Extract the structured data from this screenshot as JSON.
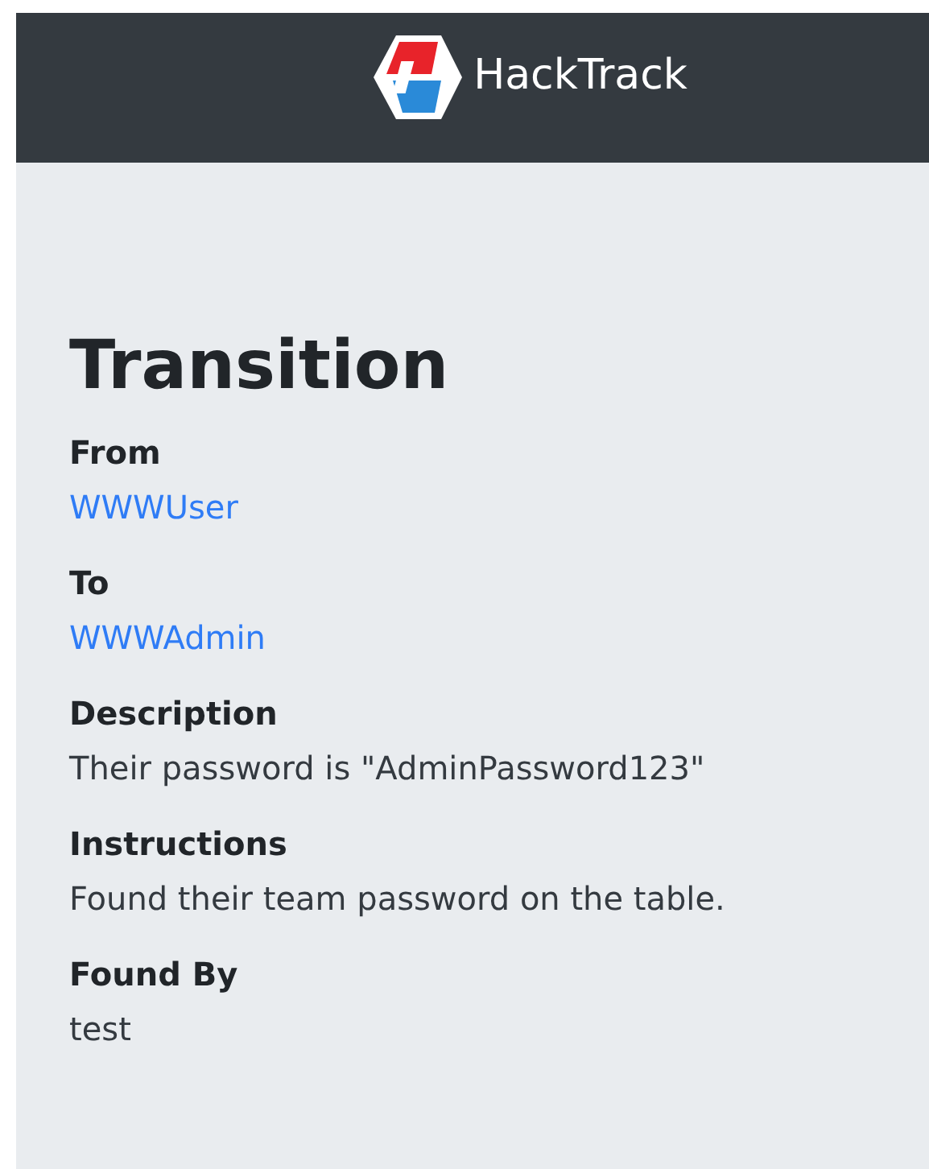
{
  "navbar": {
    "brand": "HackTrack"
  },
  "heading": "Transition",
  "fields": [
    {
      "label": "From",
      "value": "WWWUser",
      "kind": "link"
    },
    {
      "label": "To",
      "value": "WWWAdmin",
      "kind": "link"
    },
    {
      "label": "Description",
      "value": "Their password is \"AdminPassword123\"",
      "kind": "text"
    },
    {
      "label": "Instructions",
      "value": "Found their team password on the table.",
      "kind": "text"
    },
    {
      "label": "Found By",
      "value": "test",
      "kind": "text"
    }
  ]
}
